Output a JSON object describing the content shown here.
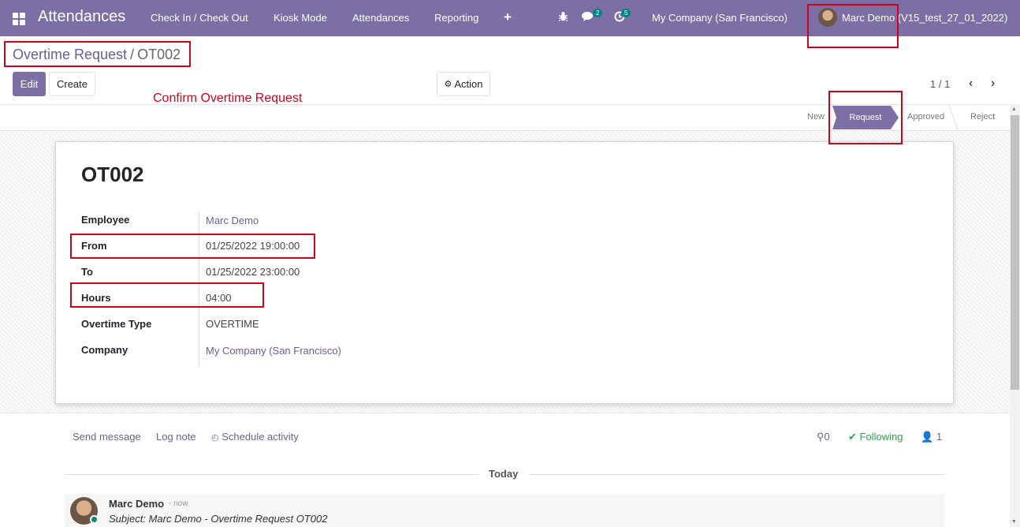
{
  "nav": {
    "app_title": "Attendances",
    "menu": [
      "Check In / Check Out",
      "Kiosk Mode",
      "Attendances",
      "Reporting"
    ],
    "plus": "+",
    "messages_count": "2",
    "activities_count": "5",
    "company": "My Company (San Francisco)",
    "user": "Marc Demo (V15_test_27_01_2022)"
  },
  "breadcrumb": {
    "parent": "Overtime Request",
    "separator": "/",
    "current": "OT002"
  },
  "buttons": {
    "edit": "Edit",
    "create": "Create",
    "action": "Action"
  },
  "pager": "1 / 1",
  "annotation": "Confirm Overtime Request",
  "stages": {
    "new": "New",
    "request": "Request",
    "approved": "Approved",
    "reject": "Reject",
    "active": "Request"
  },
  "record": {
    "name": "OT002",
    "fields": [
      {
        "label": "Employee",
        "value": "Marc Demo"
      },
      {
        "label": "From",
        "value": "01/25/2022 19:00:00"
      },
      {
        "label": "To",
        "value": "01/25/2022 23:00:00"
      },
      {
        "label": "Hours",
        "value": "04:00"
      },
      {
        "label": "Overtime Type",
        "value": "OVERTIME"
      },
      {
        "label": "Company",
        "value": "My Company (San Francisco)"
      }
    ]
  },
  "chatter": {
    "send_message": "Send message",
    "log_note": "Log note",
    "schedule_activity": "Schedule activity",
    "attachments": "0",
    "following": "Following",
    "followers": "1",
    "today": "Today",
    "message": {
      "author": "Marc Demo",
      "time": "- now",
      "subject": "Subject: Marc Demo - Overtime Request OT002"
    }
  },
  "colors": {
    "brand": "#7c6fa6",
    "annotation": "#d0021b",
    "badge": "#008784",
    "following": "#28a745"
  }
}
